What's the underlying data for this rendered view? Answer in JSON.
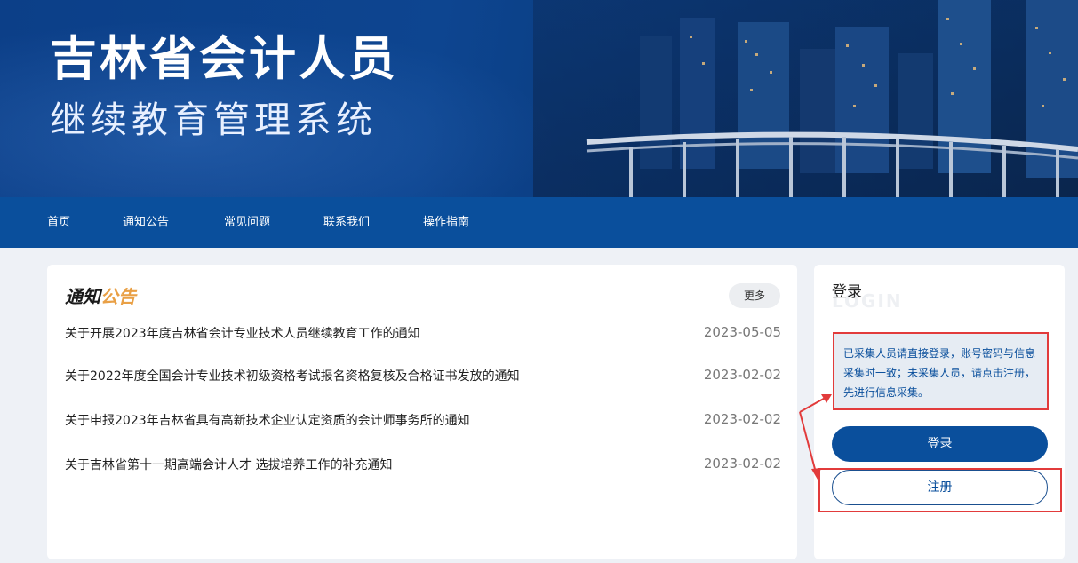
{
  "banner": {
    "title_main": "吉林省会计人员",
    "title_sub": "继续教育管理系统"
  },
  "nav": {
    "items": [
      {
        "label": "首页"
      },
      {
        "label": "通知公告"
      },
      {
        "label": "常见问题"
      },
      {
        "label": "联系我们"
      },
      {
        "label": "操作指南"
      }
    ]
  },
  "notice": {
    "heading_part1": "通知",
    "heading_part2": "公告",
    "more_label": "更多",
    "rows": [
      {
        "title": "关于开展2023年度吉林省会计专业技术人员继续教育工作的通知",
        "date": "2023-05-05"
      },
      {
        "title": "关于2022年度全国会计专业技术初级资格考试报名资格复核及合格证书发放的通知",
        "date": "2023-02-02"
      },
      {
        "title": "关于申报2023年吉林省具有高新技术企业认定资质的会计师事务所的通知",
        "date": "2023-02-02"
      },
      {
        "title": "关于吉林省第十一期高端会计人才 选拔培养工作的补充通知",
        "date": "2023-02-02"
      }
    ]
  },
  "login": {
    "heading": "登录",
    "heading_ghost": "LOGIN",
    "tip": "已采集人员请直接登录，账号密码与信息采集时一致；未采集人员，请点击注册，先进行信息采集。",
    "login_label": "登录",
    "register_label": "注册"
  },
  "colors": {
    "primary": "#0a4f9c",
    "accent": "#e9a046",
    "highlight": "#e23b3b"
  }
}
